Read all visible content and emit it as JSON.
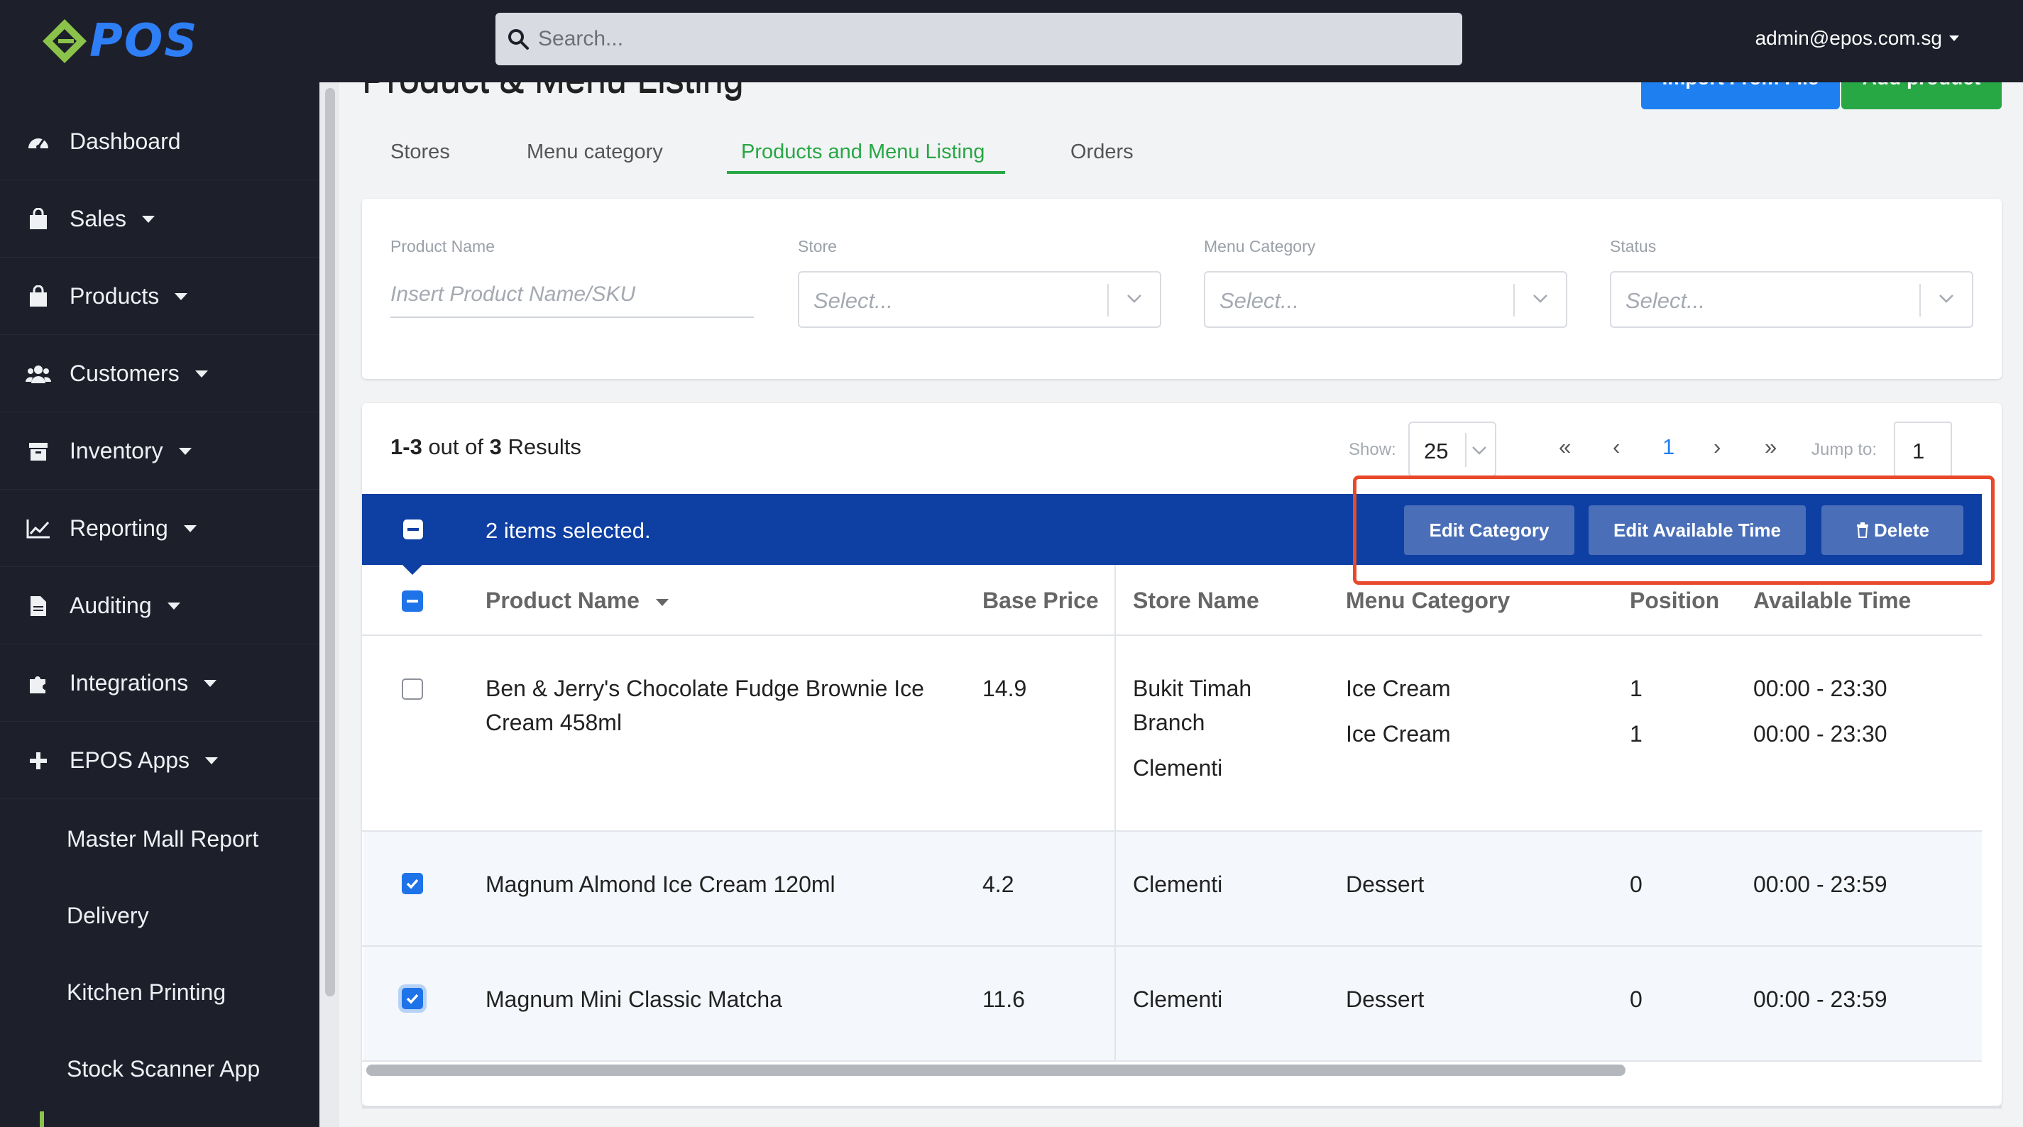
{
  "brand": {
    "logo_text": "POS",
    "accent": "#28a745",
    "primary": "#1e80f0"
  },
  "search": {
    "placeholder": "Search..."
  },
  "user": {
    "email": "admin@epos.com.sg"
  },
  "sidebar": {
    "items": [
      {
        "label": "Dashboard",
        "icon": "dashboard-icon",
        "has_caret": false
      },
      {
        "label": "Sales",
        "icon": "shopping-bag-icon",
        "has_caret": true
      },
      {
        "label": "Products",
        "icon": "shopping-bag-icon",
        "has_caret": true
      },
      {
        "label": "Customers",
        "icon": "users-icon",
        "has_caret": true
      },
      {
        "label": "Inventory",
        "icon": "archive-icon",
        "has_caret": true
      },
      {
        "label": "Reporting",
        "icon": "chart-line-icon",
        "has_caret": true
      },
      {
        "label": "Auditing",
        "icon": "file-icon",
        "has_caret": true
      },
      {
        "label": "Integrations",
        "icon": "puzzle-icon",
        "has_caret": true
      },
      {
        "label": "EPOS Apps",
        "icon": "plus-icon",
        "has_caret": true
      }
    ],
    "sub_items": [
      "Master Mall Report",
      "Delivery",
      "Kitchen Printing",
      "Stock Scanner App"
    ]
  },
  "page": {
    "title": "Product & Menu Listing",
    "import_button": "Import From File",
    "add_button": "Add product"
  },
  "tabs": [
    "Stores",
    "Menu category",
    "Products and Menu Listing",
    "Orders"
  ],
  "active_tab": "Products and Menu Listing",
  "filters": {
    "product_name": {
      "label": "Product Name",
      "placeholder": "Insert Product Name/SKU"
    },
    "store": {
      "label": "Store",
      "placeholder": "Select..."
    },
    "menu_category": {
      "label": "Menu Category",
      "placeholder": "Select..."
    },
    "status": {
      "label": "Status",
      "placeholder": "Select..."
    }
  },
  "results": {
    "range": "1-3",
    "out_of": "out of",
    "total": "3",
    "suffix": "Results",
    "show_label": "Show:",
    "page_size": "25",
    "first": "«",
    "prev": "‹",
    "current_page": "1",
    "next": "›",
    "last": "»",
    "jump_label": "Jump to:",
    "jump_value": "1"
  },
  "selection": {
    "text": "2 items selected.",
    "edit_category": "Edit Category",
    "edit_time": "Edit Available Time",
    "delete": "Delete"
  },
  "table": {
    "headers": {
      "product_name": "Product Name",
      "base_price": "Base Price",
      "store_name": "Store Name",
      "menu_category": "Menu Category",
      "position": "Position",
      "available_time": "Available Time"
    },
    "rows": [
      {
        "checked": false,
        "name_line1": "Ben & Jerry's Chocolate Fudge Brownie Ice",
        "name_line2": "Cream 458ml",
        "price": "14.9",
        "stores": [
          "Bukit Timah",
          "Branch",
          "Clementi"
        ],
        "categories": [
          "Ice Cream",
          "Ice Cream"
        ],
        "positions": [
          "1",
          "1"
        ],
        "times": [
          "00:00 - 23:30",
          "00:00 - 23:30"
        ]
      },
      {
        "checked": true,
        "name_line1": "Magnum Almond Ice Cream 120ml",
        "price": "4.2",
        "stores": [
          "Clementi"
        ],
        "categories": [
          "Dessert"
        ],
        "positions": [
          "0"
        ],
        "times": [
          "00:00 - 23:59"
        ]
      },
      {
        "checked": true,
        "name_line1": "Magnum Mini Classic Matcha",
        "price": "11.6",
        "stores": [
          "Clementi"
        ],
        "categories": [
          "Dessert"
        ],
        "positions": [
          "0"
        ],
        "times": [
          "00:00 - 23:59"
        ]
      }
    ]
  }
}
